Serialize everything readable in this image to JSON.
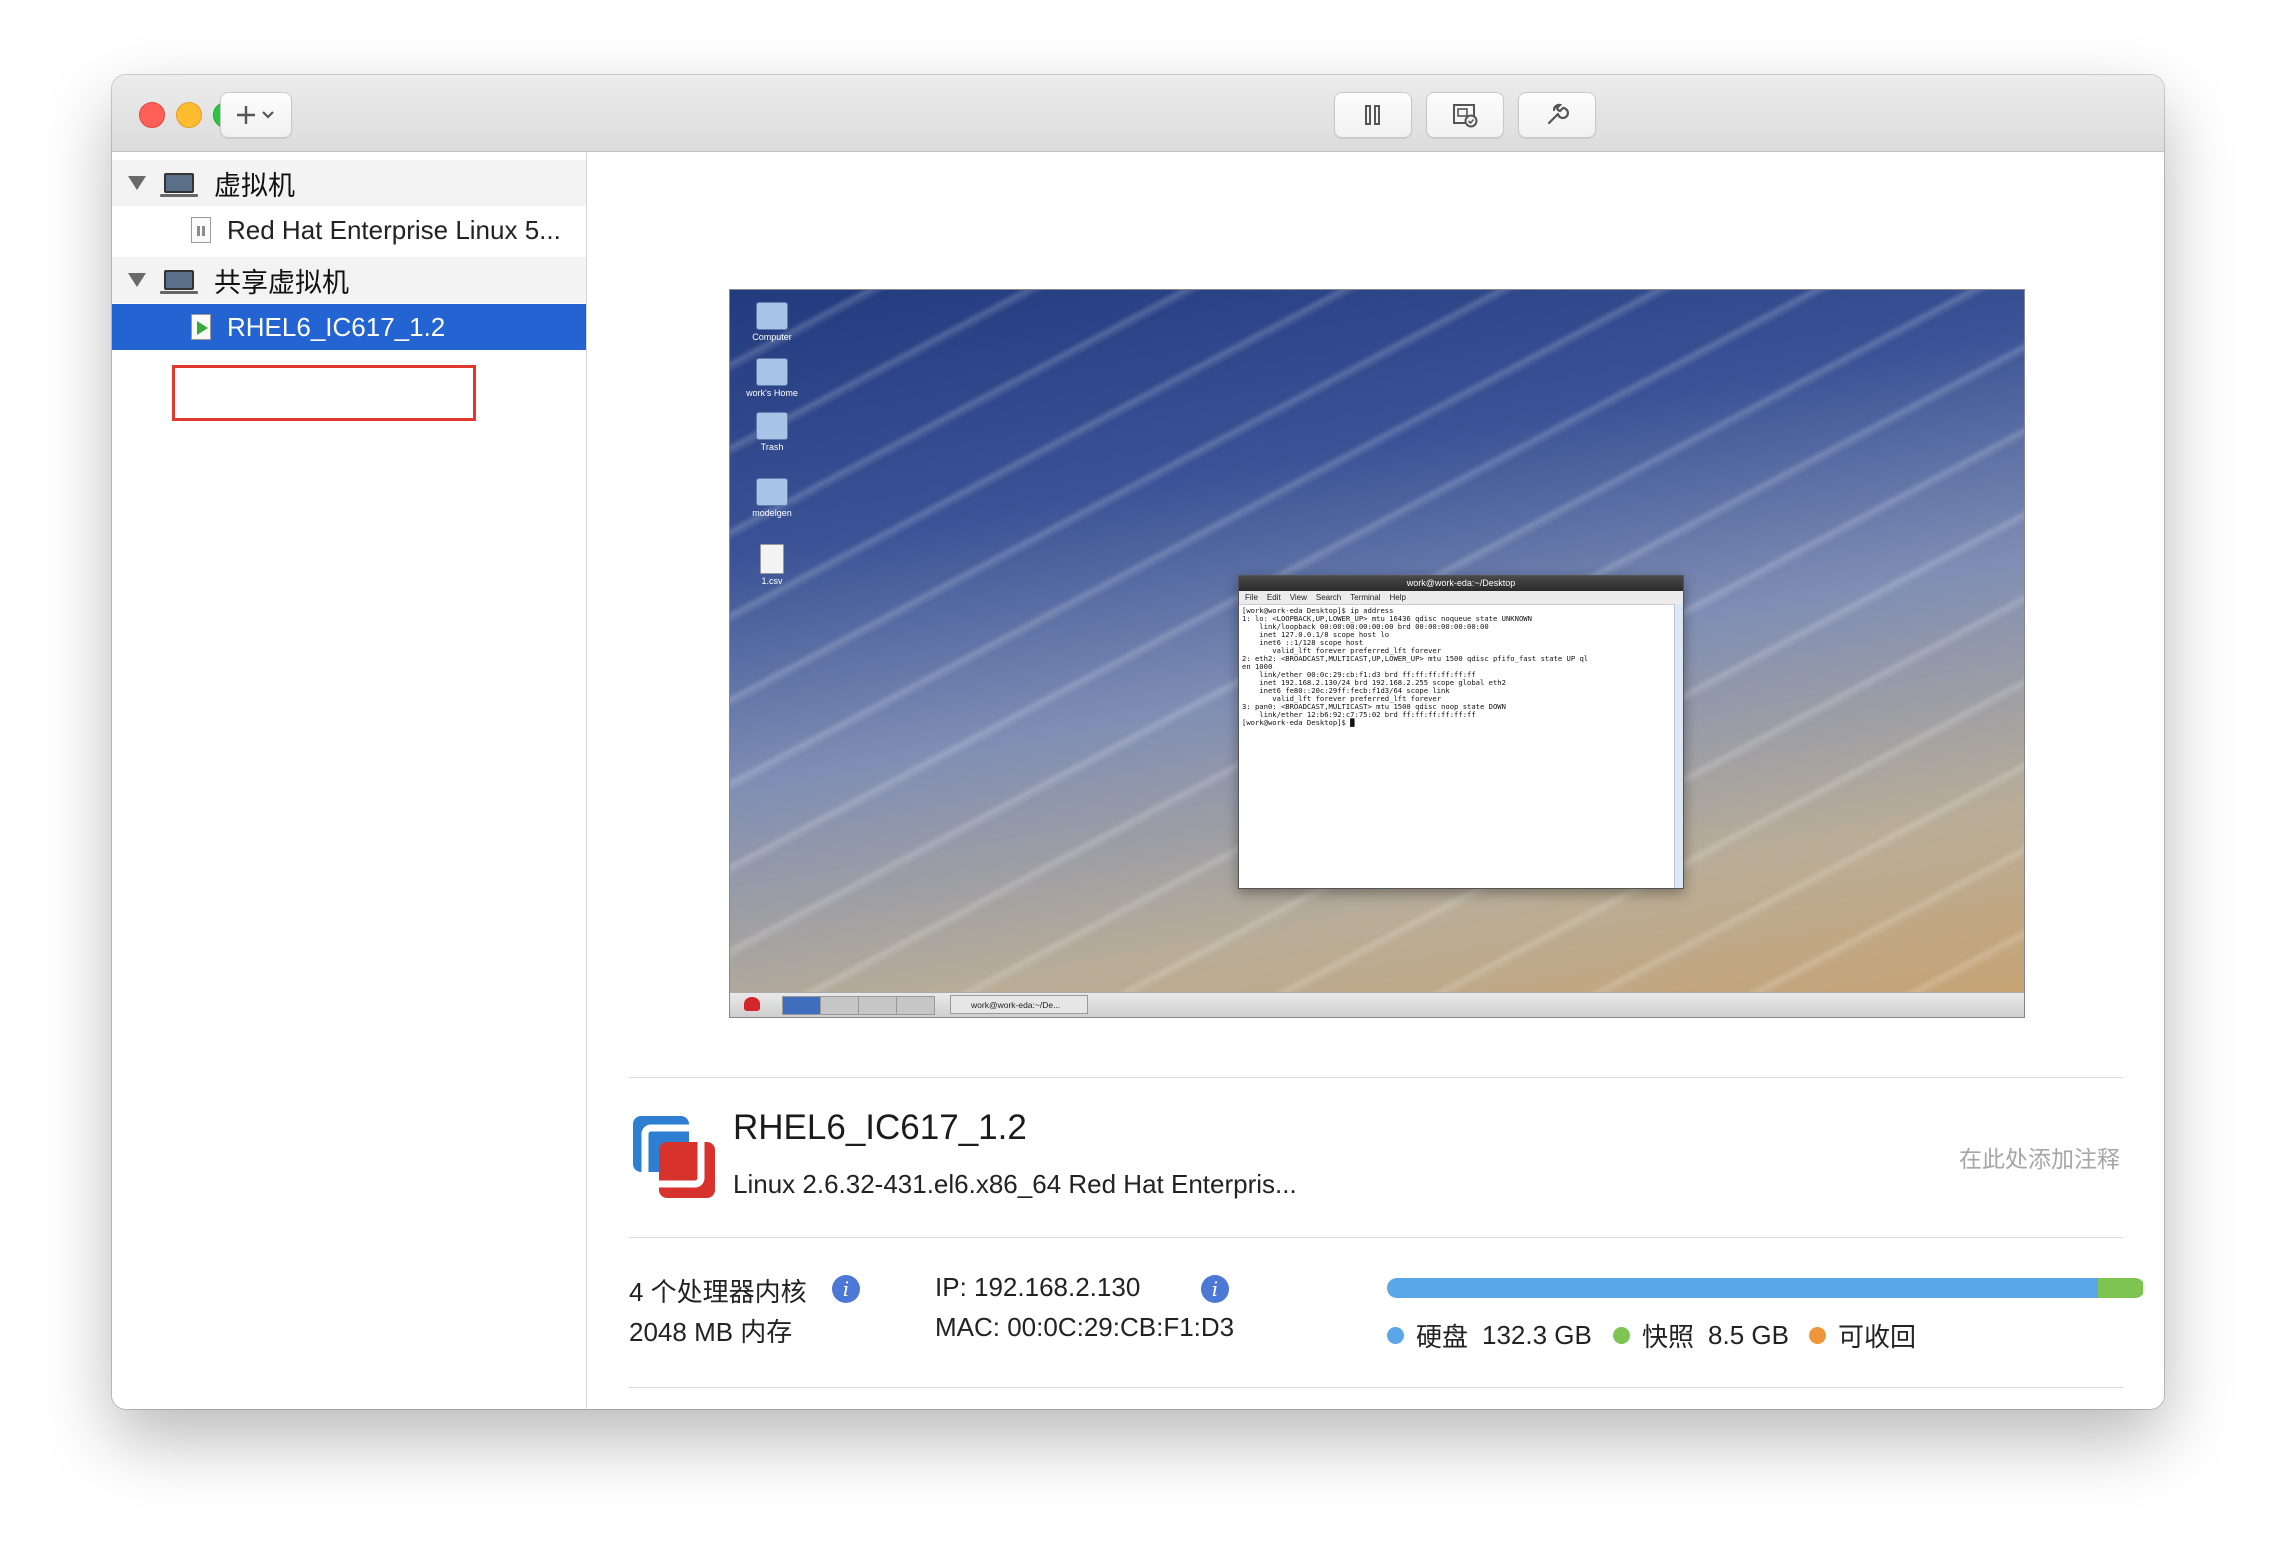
{
  "toolbar": {
    "add_icon": "plus-chevron-icon",
    "pause_icon": "pause-icon",
    "snapshot_icon": "snapshot-icon",
    "settings_icon": "wrench-icon"
  },
  "sidebar": {
    "groups": [
      {
        "label": "虚拟机",
        "items": [
          {
            "label": "Red Hat Enterprise Linux 5...",
            "state": "suspended"
          }
        ]
      },
      {
        "label": "共享虚拟机",
        "items": [
          {
            "label": "RHEL6_IC617_1.2",
            "state": "running",
            "selected": true
          }
        ]
      }
    ]
  },
  "vm_screen": {
    "desktop_icons": [
      "Computer",
      "work's Home",
      "Trash",
      "modelgen",
      "1.csv"
    ],
    "terminal": {
      "title": "work@work-eda:~/Desktop",
      "menu": [
        "File",
        "Edit",
        "View",
        "Search",
        "Terminal",
        "Help"
      ],
      "lines": [
        "[work@work-eda Desktop]$ ip address",
        "1: lo: <LOOPBACK,UP,LOWER_UP> mtu 16436 qdisc noqueue state UNKNOWN",
        "    link/loopback 00:00:00:00:00:00 brd 00:00:00:00:00:00",
        "    inet 127.0.0.1/8 scope host lo",
        "    inet6 ::1/128 scope host",
        "       valid_lft forever preferred_lft forever",
        "2: eth2: <BROADCAST,MULTICAST,UP,LOWER_UP> mtu 1500 qdisc pfifo_fast state UP ql",
        "en 1000",
        "    link/ether 00:0c:29:cb:f1:d3 brd ff:ff:ff:ff:ff:ff",
        "    inet 192.168.2.130/24 brd 192.168.2.255 scope global eth2",
        "    inet6 fe80::20c:29ff:fecb:f1d3/64 scope link",
        "       valid_lft forever preferred_lft forever",
        "3: pan0: <BROADCAST,MULTICAST> mtu 1500 qdisc noop state DOWN",
        "    link/ether 12:b6:92:c7:75:02 brd ff:ff:ff:ff:ff:ff",
        "[work@work-eda Desktop]$ █"
      ]
    },
    "taskbar_task": "work@work-eda:~/De..."
  },
  "details": {
    "name": "RHEL6_IC617_1.2",
    "os": "Linux 2.6.32-431.el6.x86_64 Red Hat Enterpris...",
    "note_placeholder": "在此处添加注释",
    "cpu": "4 个处理器内核",
    "memory": "2048 MB 内存",
    "ip": "IP: 192.168.2.130",
    "mac": "MAC: 00:0C:29:CB:F1:D3"
  },
  "storage": {
    "segments": [
      {
        "name": "硬盘",
        "value": "132.3 GB",
        "color": "#5aa6e8",
        "fraction": 0.938
      },
      {
        "name": "快照",
        "value": "8.5 GB",
        "color": "#7dc453",
        "fraction": 0.06
      },
      {
        "name": "可收回",
        "value": "",
        "color": "#f0963a",
        "fraction": 0.0
      }
    ]
  }
}
